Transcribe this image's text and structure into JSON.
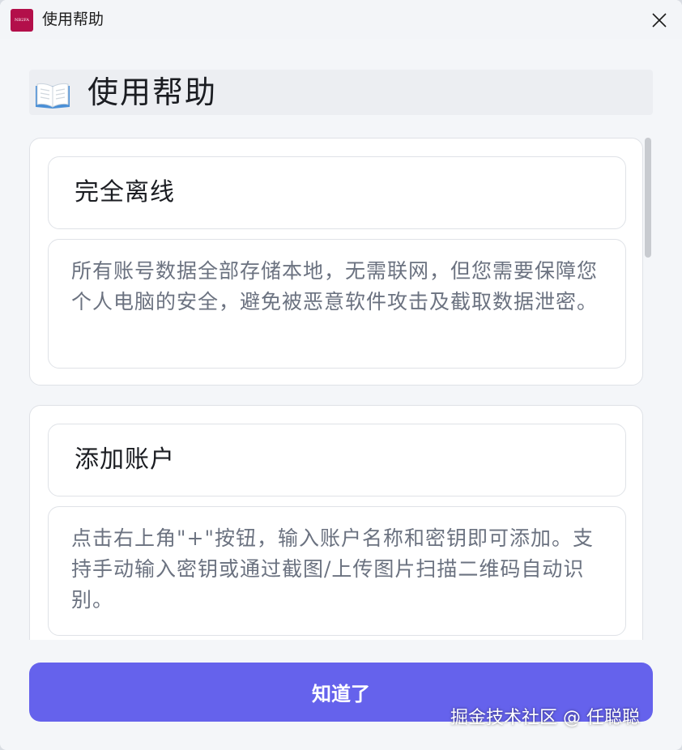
{
  "window": {
    "title": "使用帮助",
    "app_icon_text": "NB2FA"
  },
  "header": {
    "icon": "open-book-icon",
    "title": "使用帮助"
  },
  "sections": [
    {
      "title": "完全离线",
      "body": "所有账号数据全部存储本地，无需联网，但您需要保障您个人电脑的安全，避免被恶意软件攻击及截取数据泄密。"
    },
    {
      "title": "添加账户",
      "body": "点击右上角\"+\"按钮，输入账户名称和密钥即可添加。支持手动输入密钥或通过截图/上传图片扫描二维码自动识别。"
    }
  ],
  "footer": {
    "confirm_label": "知道了"
  },
  "watermark": "掘金技术社区 @ 任聪聪",
  "colors": {
    "accent": "#6562ec",
    "app_icon": "#b30f4a"
  }
}
